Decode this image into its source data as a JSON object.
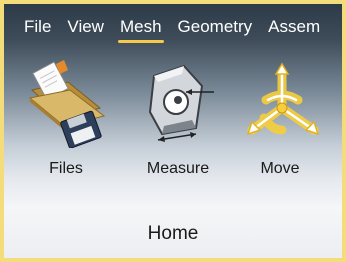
{
  "menu": {
    "items": [
      {
        "label": "File"
      },
      {
        "label": "View"
      },
      {
        "label": "Mesh",
        "active": true
      },
      {
        "label": "Geometry"
      },
      {
        "label": "Assem"
      }
    ]
  },
  "tools": [
    {
      "label": "Files",
      "icon": "folder-files-icon"
    },
    {
      "label": "Measure",
      "icon": "measure-icon"
    },
    {
      "label": "Move",
      "icon": "move-arrows-icon"
    }
  ],
  "tab": {
    "label": "Home"
  },
  "colors": {
    "frame_border": "#f3dc79",
    "active_underline": "#f6c94a",
    "ribbon_top": "#2d3a47",
    "move_glow": "#f7cf3a"
  }
}
